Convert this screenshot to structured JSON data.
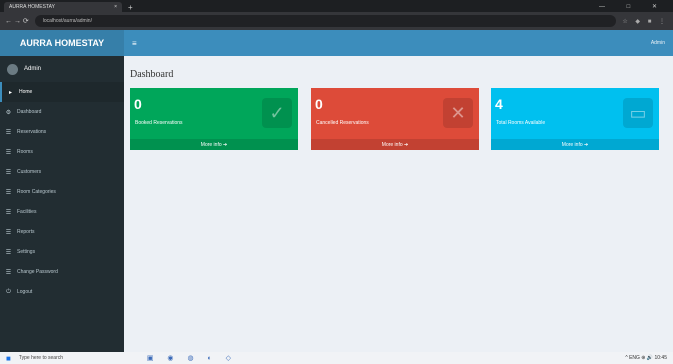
{
  "browser": {
    "tab_title": "AURRA HOMESTAY",
    "tab_close": "×",
    "new_tab": "+",
    "window_controls": "— □ ✕",
    "nav_icons": "←  →  ⟳",
    "url": "localhost/aurra/admin/",
    "extensions": "☆ ◆ ■ ⋮"
  },
  "header": {
    "logo": "AURRA HOMESTAY",
    "menu_toggle": "≡",
    "user_menu": "Admin"
  },
  "sidebar": {
    "user_name": "Admin",
    "items": [
      {
        "icon": "▸",
        "label": "Home"
      },
      {
        "icon": "⚙",
        "label": "Dashboard"
      },
      {
        "icon": "☰",
        "label": "Reservations"
      },
      {
        "icon": "☰",
        "label": "Rooms"
      },
      {
        "icon": "☰",
        "label": "Customers"
      },
      {
        "icon": "☰",
        "label": "Room Categories"
      },
      {
        "icon": "☰",
        "label": "Facilities"
      },
      {
        "icon": "☰",
        "label": "Reports"
      },
      {
        "icon": "☰",
        "label": "Settings"
      },
      {
        "icon": "☰",
        "label": "Change Password"
      },
      {
        "icon": "⏻",
        "label": "Logout"
      }
    ]
  },
  "main": {
    "title": "Dashboard",
    "boxes": [
      {
        "count": "0",
        "label": "Booked Reservations",
        "icon": "✓",
        "footer": "More info ➔"
      },
      {
        "count": "0",
        "label": "Cancelled Reservations",
        "icon": "✕",
        "footer": "More info ➔"
      },
      {
        "count": "4",
        "label": "Total Rooms Available",
        "icon": "▭",
        "footer": "More info ➔"
      }
    ]
  },
  "taskbar": {
    "start": "■",
    "search": "Type here to search",
    "apps": "▣ ◉ ◍ ◐ ◇",
    "tray": "^ ENG ⊕ 🔊 10:45"
  },
  "colors": {
    "sidebar": "#222d32",
    "header": "#3c8dbc",
    "green": "#00a65a",
    "red": "#dd4b39",
    "aqua": "#00c0ef"
  }
}
